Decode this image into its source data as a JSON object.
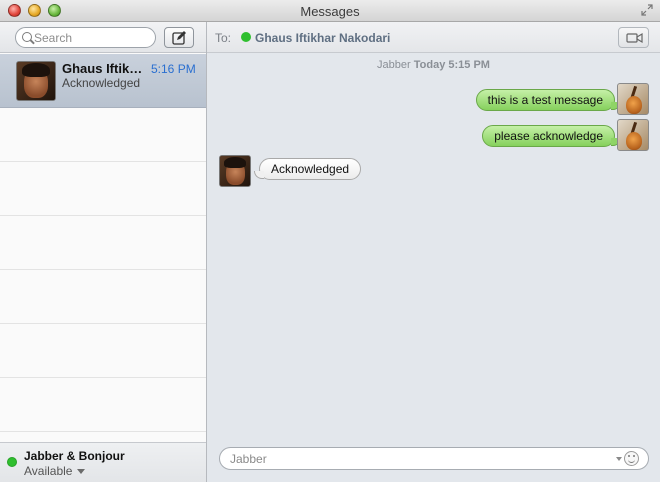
{
  "window": {
    "title": "Messages"
  },
  "sidebar": {
    "search": {
      "placeholder": "Search",
      "value": ""
    },
    "conversations": [
      {
        "name": "Ghaus Iftikhar Nakodari",
        "time": "5:16 PM",
        "preview": "Acknowledged"
      }
    ],
    "account": {
      "name": "Jabber & Bonjour",
      "status": "Available"
    }
  },
  "main": {
    "to_label": "To:",
    "recipient": "Ghaus Iftikhar Nakodari",
    "timestamp": {
      "service": "Jabber",
      "when": "Today 5:15 PM"
    },
    "messages": [
      {
        "direction": "outgoing",
        "text": "this is a test message"
      },
      {
        "direction": "outgoing",
        "text": "please acknowledge"
      },
      {
        "direction": "incoming",
        "text": "Acknowledged"
      }
    ],
    "input": {
      "placeholder": "Jabber",
      "value": ""
    }
  },
  "colors": {
    "status_available": "#2fbf2f",
    "outgoing_bubble": "#86d15d",
    "time_accent": "#2a6fd0",
    "selected_row": "#c9d1dc"
  },
  "icons": [
    "search-icon",
    "compose-icon",
    "video-camera-icon",
    "emoji-icon",
    "fullscreen-icon"
  ]
}
